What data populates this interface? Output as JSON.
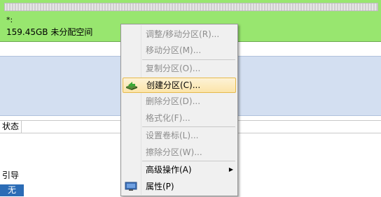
{
  "partition": {
    "name": "*:",
    "info": "159.45GB 未分配空间",
    "color": "#98e66f"
  },
  "grid": {
    "status_header": "状态"
  },
  "boot": {
    "label": "引导",
    "value": "无"
  },
  "context_menu": {
    "items": [
      {
        "label": "调整/移动分区(R)...",
        "enabled": false
      },
      {
        "label": "移动分区(M)...",
        "enabled": false
      },
      {
        "label": "复制分区(O)...",
        "enabled": false
      },
      {
        "label": "创建分区(C)...",
        "enabled": true,
        "highlighted": true,
        "icon": "create-partition-icon"
      },
      {
        "label": "删除分区(D)...",
        "enabled": false
      },
      {
        "label": "格式化(F)...",
        "enabled": false
      },
      {
        "label": "设置卷标(L)...",
        "enabled": false
      },
      {
        "label": "擦除分区(W)...",
        "enabled": false
      },
      {
        "label": "高级操作(A)",
        "enabled": true,
        "submenu": true
      },
      {
        "label": "属性(P)",
        "enabled": true,
        "icon": "properties-icon"
      }
    ]
  }
}
